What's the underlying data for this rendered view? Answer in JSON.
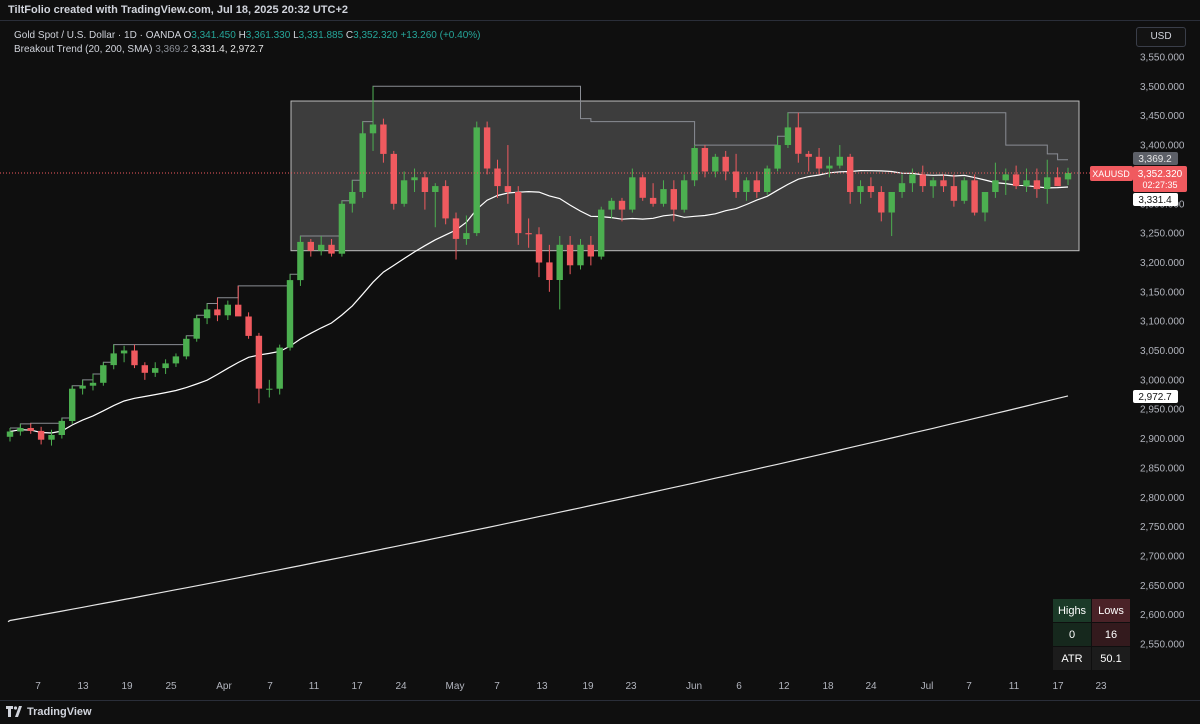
{
  "header": {
    "attribution": "TiltFolio created with TradingView.com, Jul 18, 2025 20:32 UTC+2",
    "symbol_title": "Gold Spot / U.S. Dollar · 1D · OANDA",
    "ohlc": {
      "o_label": "O",
      "o": "3,341.450",
      "h_label": "H",
      "h": "3,361.330",
      "l_label": "L",
      "l": "3,331.885",
      "c_label": "C",
      "c": "3,352.320",
      "change": "+13.260 (+0.40%)"
    },
    "indicator_name": "Breakout Trend (20, 200, SMA)",
    "indicator_values": [
      "3,369.2",
      "3,331.4",
      "2,972.7"
    ]
  },
  "currency_button": "USD",
  "footer": {
    "brand": "TradingView"
  },
  "price_tags": {
    "symbol": "XAUUSD",
    "last": "3,352.320",
    "countdown": "02:27:35",
    "upper": "3,369.2",
    "sma20": "3,331.4",
    "sma200": "2,972.7"
  },
  "stats_table": {
    "highs_label": "Highs",
    "lows_label": "Lows",
    "highs_value": "0",
    "lows_value": "16",
    "atr_label": "ATR",
    "atr_value": "50.1"
  },
  "colors": {
    "up": "#4caf50",
    "down": "#f05a5f",
    "background": "#0f0f0f",
    "box": "#d0d0d0"
  },
  "chart_data": {
    "type": "candlestick",
    "title": "Gold Spot / U.S. Dollar · 1D · OANDA",
    "ylim": [
      2500,
      3600
    ],
    "y_ticks": [
      2550,
      2600,
      2650,
      2700,
      2750,
      2800,
      2850,
      2900,
      2950,
      3000,
      3050,
      3100,
      3150,
      3200,
      3250,
      3300,
      3350,
      3400,
      3450,
      3500,
      3550
    ],
    "x_ticks": [
      "7",
      "13",
      "19",
      "25",
      "Apr",
      "7",
      "11",
      "17",
      "24",
      "May",
      "7",
      "13",
      "19",
      "23",
      "Jun",
      "6",
      "12",
      "18",
      "24",
      "Jul",
      "7",
      "11",
      "17",
      "23"
    ],
    "grid": false,
    "candles": [
      [
        2903,
        2918,
        2895,
        2912
      ],
      [
        2912,
        2925,
        2905,
        2918
      ],
      [
        2918,
        2926,
        2908,
        2913
      ],
      [
        2913,
        2920,
        2890,
        2898
      ],
      [
        2898,
        2915,
        2888,
        2906
      ],
      [
        2906,
        2935,
        2900,
        2930
      ],
      [
        2930,
        2990,
        2925,
        2985
      ],
      [
        2985,
        3000,
        2975,
        2990
      ],
      [
        2990,
        3010,
        2982,
        2995
      ],
      [
        2995,
        3030,
        2990,
        3025
      ],
      [
        3025,
        3060,
        3018,
        3045
      ],
      [
        3045,
        3058,
        3030,
        3050
      ],
      [
        3050,
        3060,
        3020,
        3025
      ],
      [
        3025,
        3030,
        3000,
        3012
      ],
      [
        3012,
        3030,
        3005,
        3020
      ],
      [
        3020,
        3035,
        3010,
        3028
      ],
      [
        3028,
        3045,
        3022,
        3040
      ],
      [
        3040,
        3075,
        3035,
        3070
      ],
      [
        3070,
        3110,
        3065,
        3105
      ],
      [
        3105,
        3130,
        3095,
        3120
      ],
      [
        3120,
        3140,
        3100,
        3110
      ],
      [
        3110,
        3135,
        3102,
        3128
      ],
      [
        3128,
        3160,
        3118,
        3108
      ],
      [
        3108,
        3115,
        3070,
        3075
      ],
      [
        3075,
        3080,
        2960,
        2985
      ],
      [
        2985,
        3000,
        2970,
        2985
      ],
      [
        2985,
        3060,
        2975,
        3055
      ],
      [
        3055,
        3180,
        3050,
        3170
      ],
      [
        3170,
        3245,
        3160,
        3235
      ],
      [
        3235,
        3240,
        3210,
        3220
      ],
      [
        3220,
        3245,
        3212,
        3230
      ],
      [
        3230,
        3240,
        3210,
        3215
      ],
      [
        3215,
        3305,
        3210,
        3300
      ],
      [
        3300,
        3340,
        3285,
        3320
      ],
      [
        3320,
        3440,
        3310,
        3420
      ],
      [
        3420,
        3500,
        3390,
        3435
      ],
      [
        3435,
        3445,
        3370,
        3385
      ],
      [
        3385,
        3390,
        3290,
        3300
      ],
      [
        3300,
        3355,
        3295,
        3340
      ],
      [
        3340,
        3360,
        3320,
        3345
      ],
      [
        3345,
        3355,
        3290,
        3320
      ],
      [
        3320,
        3335,
        3260,
        3330
      ],
      [
        3330,
        3340,
        3265,
        3275
      ],
      [
        3275,
        3285,
        3205,
        3240
      ],
      [
        3240,
        3280,
        3230,
        3250
      ],
      [
        3250,
        3440,
        3245,
        3430
      ],
      [
        3430,
        3440,
        3350,
        3360
      ],
      [
        3360,
        3375,
        3310,
        3330
      ],
      [
        3330,
        3400,
        3300,
        3320
      ],
      [
        3320,
        3330,
        3230,
        3250
      ],
      [
        3250,
        3275,
        3225,
        3248
      ],
      [
        3248,
        3260,
        3175,
        3200
      ],
      [
        3200,
        3230,
        3150,
        3170
      ],
      [
        3170,
        3245,
        3120,
        3230
      ],
      [
        3230,
        3245,
        3180,
        3195
      ],
      [
        3195,
        3240,
        3188,
        3230
      ],
      [
        3230,
        3245,
        3195,
        3210
      ],
      [
        3210,
        3295,
        3205,
        3290
      ],
      [
        3290,
        3310,
        3275,
        3305
      ],
      [
        3305,
        3310,
        3270,
        3290
      ],
      [
        3290,
        3360,
        3285,
        3345
      ],
      [
        3345,
        3350,
        3305,
        3310
      ],
      [
        3310,
        3335,
        3295,
        3300
      ],
      [
        3300,
        3340,
        3295,
        3325
      ],
      [
        3325,
        3340,
        3270,
        3290
      ],
      [
        3290,
        3350,
        3285,
        3340
      ],
      [
        3340,
        3400,
        3330,
        3395
      ],
      [
        3395,
        3400,
        3345,
        3355
      ],
      [
        3355,
        3385,
        3345,
        3380
      ],
      [
        3380,
        3390,
        3340,
        3355
      ],
      [
        3355,
        3385,
        3310,
        3320
      ],
      [
        3320,
        3345,
        3305,
        3340
      ],
      [
        3340,
        3355,
        3310,
        3320
      ],
      [
        3320,
        3365,
        3315,
        3360
      ],
      [
        3360,
        3415,
        3355,
        3400
      ],
      [
        3400,
        3455,
        3395,
        3430
      ],
      [
        3430,
        3455,
        3370,
        3385
      ],
      [
        3385,
        3390,
        3355,
        3380
      ],
      [
        3380,
        3395,
        3350,
        3360
      ],
      [
        3360,
        3380,
        3345,
        3365
      ],
      [
        3365,
        3400,
        3360,
        3380
      ],
      [
        3380,
        3385,
        3300,
        3320
      ],
      [
        3320,
        3340,
        3300,
        3330
      ],
      [
        3330,
        3345,
        3310,
        3320
      ],
      [
        3320,
        3330,
        3270,
        3285
      ],
      [
        3285,
        3310,
        3245,
        3320
      ],
      [
        3320,
        3350,
        3310,
        3335
      ],
      [
        3335,
        3360,
        3320,
        3350
      ],
      [
        3350,
        3365,
        3320,
        3330
      ],
      [
        3330,
        3345,
        3310,
        3340
      ],
      [
        3340,
        3350,
        3320,
        3330
      ],
      [
        3330,
        3350,
        3295,
        3305
      ],
      [
        3305,
        3345,
        3300,
        3340
      ],
      [
        3340,
        3350,
        3280,
        3285
      ],
      [
        3285,
        3320,
        3270,
        3320
      ],
      [
        3320,
        3370,
        3310,
        3340
      ],
      [
        3340,
        3360,
        3315,
        3350
      ],
      [
        3350,
        3365,
        3325,
        3330
      ],
      [
        3330,
        3360,
        3320,
        3340
      ],
      [
        3340,
        3360,
        3310,
        3325
      ],
      [
        3325,
        3375,
        3300,
        3345
      ],
      [
        3345,
        3362,
        3330,
        3330
      ],
      [
        3341.45,
        3361.33,
        3331.885,
        3352.32
      ]
    ],
    "consolidation_box": {
      "x_start_index": 32,
      "x_end_index": 120,
      "y_low": 3220,
      "y_high": 3475
    }
  }
}
